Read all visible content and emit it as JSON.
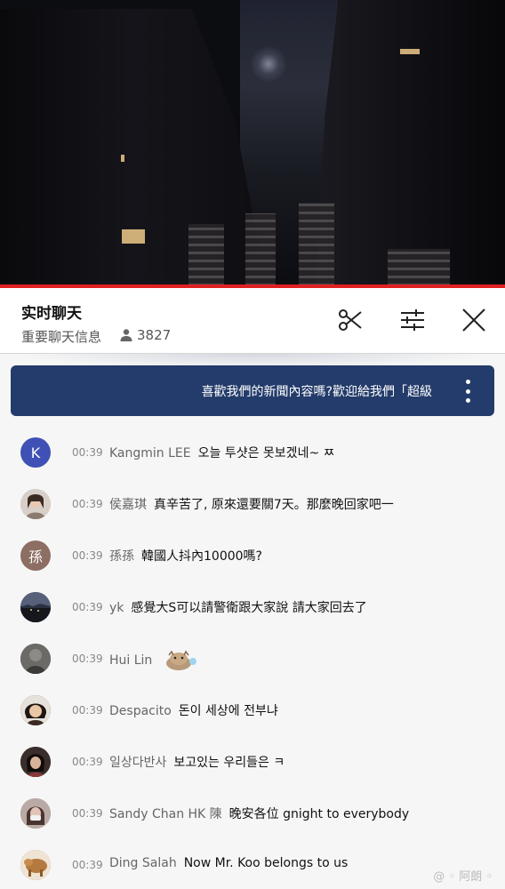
{
  "chat_header": {
    "title": "实时聊天",
    "mode_label": "重要聊天信息",
    "viewer_count": "3827"
  },
  "icons": {
    "viewer": "person-icon",
    "scissors": "scissors-icon",
    "filter": "sliders-icon",
    "close": "close-icon",
    "more": "more-vertical-icon"
  },
  "banner": {
    "text": "喜歡我們的新聞內容嗎?歡迎給我們「超級"
  },
  "messages": [
    {
      "avatar_text": "K",
      "avatar_color": "#3f51b5",
      "time": "00:39",
      "author": "Kangmin LEE",
      "text": "오늘 투샷은 못보겠네~ ㅉ"
    },
    {
      "avatar_text": "",
      "avatar_color": "#8a7a70",
      "time": "00:39",
      "author": "侯嘉琪",
      "text": "真辛苦了, 原來還要關7天。那麼晚回家吧一"
    },
    {
      "avatar_text": "孫",
      "avatar_color": "#8d6e63",
      "time": "00:39",
      "author": "孫孫",
      "text": "韓國人抖內10000嗎?"
    },
    {
      "avatar_text": "",
      "avatar_color": "#2b3140",
      "time": "00:39",
      "author": "yk",
      "text": "感覺大S可以請警衛跟大家說 請大家回去了"
    },
    {
      "avatar_text": "",
      "avatar_color": "#4a4a48",
      "time": "00:39",
      "author": "Hui Lin",
      "text": ""
    },
    {
      "avatar_text": "",
      "avatar_color": "#3b2a22",
      "time": "00:39",
      "author": "Despacito",
      "text": "돈이 세상에 전부냐"
    },
    {
      "avatar_text": "",
      "avatar_color": "#2d2222",
      "time": "00:39",
      "author": "일상다반사",
      "text": "보고있는 우리들은 ㅋ"
    },
    {
      "avatar_text": "",
      "avatar_color": "#7a6a68",
      "time": "00:39",
      "author": "Sandy Chan HK 陳",
      "text": "晚安各位 gnight to everybody"
    },
    {
      "avatar_text": "",
      "avatar_color": "#9a6a3a",
      "time": "00:39",
      "author": "Ding Salah",
      "text": "Now Mr. Koo belongs to us"
    }
  ],
  "watermark": "@ ◦ 阿朗 ◦"
}
